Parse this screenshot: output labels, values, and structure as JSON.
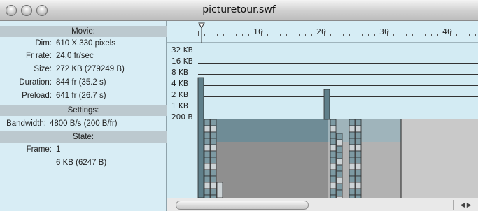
{
  "window": {
    "title": "picturetour.swf"
  },
  "movie": {
    "header": "Movie:",
    "rows": [
      {
        "label": "Dim:",
        "value": "610 X 330 pixels"
      },
      {
        "label": "Fr rate:",
        "value": "24.0 fr/sec"
      },
      {
        "label": "Size:",
        "value": "272 KB (279249 B)"
      },
      {
        "label": "Duration:",
        "value": "844 fr (35.2 s)"
      },
      {
        "label": "Preload:",
        "value": "641 fr (26.7 s)"
      }
    ]
  },
  "settings": {
    "header": "Settings:",
    "bandwidth_label": "Bandwidth:",
    "bandwidth_value": "4800 B/s (200 B/fr)"
  },
  "state": {
    "header": "State:",
    "frame_label": "Frame:",
    "frame_value": "1",
    "frame_size": "6 KB (6247 B)"
  },
  "timeline": {
    "ticks": [
      "10",
      "20",
      "30",
      "40"
    ]
  },
  "chart_data": {
    "type": "bar",
    "y_tick_labels": [
      "32 KB",
      "16 KB",
      "8 KB",
      "4 KB",
      "2 KB",
      "1 KB",
      "200 B"
    ],
    "y_scale": "log",
    "bandwidth_line": "200 B",
    "colors": {
      "bar_dark": "#5f7f8a",
      "bar_light": "#ccd3d6",
      "stream_fill": "#8a8a8a",
      "background": "#d3ebf3"
    }
  }
}
